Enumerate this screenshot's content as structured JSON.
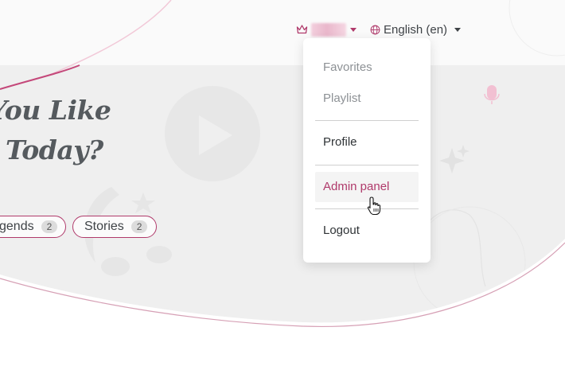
{
  "hero": {
    "headline_line1": "d You Like",
    "headline_line2": "en Today?"
  },
  "chips": [
    {
      "label": "gends",
      "count": "2"
    },
    {
      "label": "Stories",
      "count": "2"
    }
  ],
  "nav": {
    "account_icon": "crown-icon",
    "language_icon": "globe-icon",
    "language_label": "English (en)"
  },
  "dropdown": {
    "items": [
      {
        "label": "Favorites"
      },
      {
        "label": "Playlist"
      },
      {
        "label": "Profile"
      },
      {
        "label": "Admin panel"
      },
      {
        "label": "Logout"
      }
    ]
  },
  "colors": {
    "accent": "#b03a6b",
    "text": "#3f4347",
    "muted": "#8d9195",
    "hero_bg": "#efefef"
  }
}
